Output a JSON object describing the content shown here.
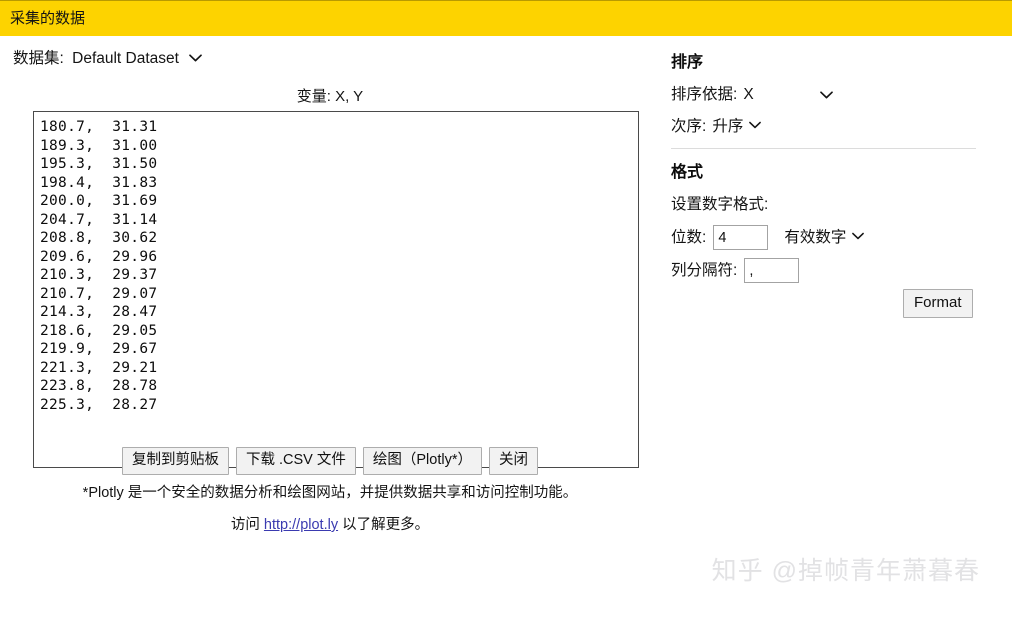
{
  "window": {
    "title": "采集的数据",
    "title_bar_color": "#fdd300"
  },
  "left": {
    "dataset_label": "数据集:",
    "dataset_value": "Default Dataset",
    "dataset_caret": "⌄",
    "variables_label": "变量: X, Y",
    "data_text": "180.7,  31.31\n189.3,  31.00\n195.3,  31.50\n198.4,  31.83\n200.0,  31.69\n204.7,  31.14\n208.8,  30.62\n209.6,  29.96\n210.3,  29.37\n210.7,  29.07\n214.3,  28.47\n218.6,  29.05\n219.9,  29.67\n221.3,  29.21\n223.8,  28.78\n225.3,  28.27",
    "buttons": [
      {
        "label": "复制到剪贴板",
        "name": "copy-to-clipboard-button"
      },
      {
        "label": "下载 .CSV 文件",
        "name": "download-csv-button"
      },
      {
        "label": "绘图（Plotly*）",
        "name": "plot-plotly-button"
      },
      {
        "label": "关闭",
        "name": "close-button"
      }
    ],
    "footnote": "*Plotly 是一个安全的数据分析和绘图网站，并提供数据共享和访问控制功能。",
    "visit_prefix": "访问 ",
    "visit_link": "http://plot.ly",
    "visit_suffix": " 以了解更多。",
    "link_color": "#3a3ab0"
  },
  "right": {
    "sort_heading": "排序",
    "sort_by_label": "排序依据:",
    "sort_by_value": "X",
    "order_label": "次序:",
    "order_value": "升序",
    "format_heading": "格式",
    "format_note": "设置数字格式:",
    "digits_label": "位数:",
    "digits_value": "4",
    "digits_unit": "有效数字",
    "separator_label": "列分隔符:",
    "separator_value": ",",
    "format_button_label": "Format",
    "caret": "⌄"
  },
  "watermark": {
    "text": "知乎 @掉帧青年萧暮春"
  },
  "chart_data": {
    "type": "table",
    "title": "采集的数据",
    "columns": [
      "X",
      "Y"
    ],
    "x": [
      180.7,
      189.3,
      195.3,
      198.4,
      200.0,
      204.7,
      208.8,
      209.6,
      210.3,
      210.7,
      214.3,
      218.6,
      219.9,
      221.3,
      223.8,
      225.3
    ],
    "y": [
      31.31,
      31.0,
      31.5,
      31.83,
      31.69,
      31.14,
      30.62,
      29.96,
      29.37,
      29.07,
      28.47,
      29.05,
      29.67,
      29.21,
      28.78,
      28.27
    ],
    "rows": [
      [
        180.7,
        31.31
      ],
      [
        189.3,
        31.0
      ],
      [
        195.3,
        31.5
      ],
      [
        198.4,
        31.83
      ],
      [
        200.0,
        31.69
      ],
      [
        204.7,
        31.14
      ],
      [
        208.8,
        30.62
      ],
      [
        209.6,
        29.96
      ],
      [
        210.3,
        29.37
      ],
      [
        210.7,
        29.07
      ],
      [
        214.3,
        28.47
      ],
      [
        218.6,
        29.05
      ],
      [
        219.9,
        29.67
      ],
      [
        221.3,
        29.21
      ],
      [
        223.8,
        28.78
      ],
      [
        225.3,
        28.27
      ]
    ],
    "xlabel": "X",
    "ylabel": "Y",
    "sorted_by": "X",
    "sort_order": "升序",
    "significant_digits": 4,
    "column_separator": ","
  }
}
